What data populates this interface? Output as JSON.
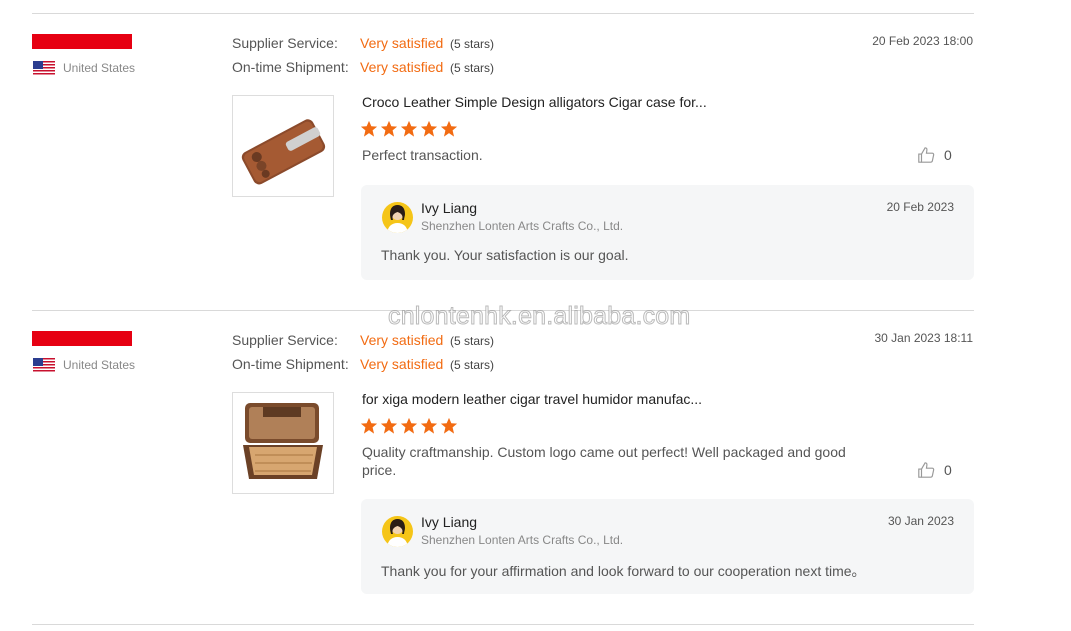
{
  "reviews": [
    {
      "country": "United States",
      "supplier_service_label": "Supplier Service:",
      "supplier_service_value": "Very satisfied",
      "supplier_service_stars": "(5 stars)",
      "shipment_label": "On-time Shipment:",
      "shipment_value": "Very satisfied",
      "shipment_stars": "(5 stars)",
      "date": "20 Feb 2023 18:00",
      "product_title": "Croco Leather Simple Design alligators Cigar case for...",
      "rating": 5,
      "comment": "Perfect transaction.",
      "likes": "0",
      "reply": {
        "name": "Ivy Liang",
        "company": "Shenzhen Lonten Arts Crafts Co., Ltd.",
        "date": "20 Feb 2023",
        "text": "Thank you. Your satisfaction is our goal."
      }
    },
    {
      "country": "United States",
      "supplier_service_label": "Supplier Service:",
      "supplier_service_value": "Very satisfied",
      "supplier_service_stars": "(5 stars)",
      "shipment_label": "On-time Shipment:",
      "shipment_value": "Very satisfied",
      "shipment_stars": "(5 stars)",
      "date": "30 Jan 2023 18:11",
      "product_title": "for xiga modern leather cigar travel humidor manufac...",
      "rating": 5,
      "comment": "Quality craftmanship. Custom logo came out perfect! Well packaged and good price.",
      "likes": "0",
      "reply": {
        "name": "Ivy Liang",
        "company": "Shenzhen Lonten Arts Crafts Co., Ltd.",
        "date": "30 Jan 2023",
        "text": "Thank you for your affirmation and look forward to our cooperation next time。"
      }
    }
  ],
  "watermark": "cnlontenhk.en.alibaba.com",
  "colors": {
    "accent": "#f26b12",
    "brand_red": "#e60012",
    "reply_bg": "#f5f6f7"
  },
  "icons": {
    "like": "thumbs-up-icon",
    "star": "star-icon",
    "flag": "us-flag-icon"
  }
}
